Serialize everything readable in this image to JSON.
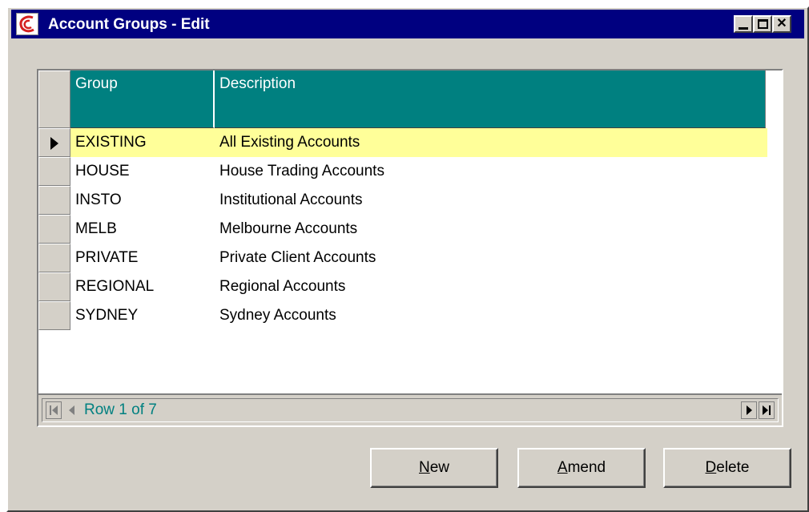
{
  "window": {
    "title": "Account Groups - Edit",
    "controls": {
      "minimize": "_",
      "maximize": "□",
      "close": "×"
    }
  },
  "grid": {
    "columns": [
      "Group",
      "Description"
    ],
    "rows": [
      {
        "group": "EXISTING",
        "description": "All Existing Accounts",
        "selected": true
      },
      {
        "group": "HOUSE",
        "description": "House Trading Accounts"
      },
      {
        "group": "INSTO",
        "description": "Institutional Accounts"
      },
      {
        "group": "MELB",
        "description": "Melbourne Accounts"
      },
      {
        "group": "PRIVATE",
        "description": "Private Client Accounts"
      },
      {
        "group": "REGIONAL",
        "description": "Regional Accounts"
      },
      {
        "group": "SYDNEY",
        "description": "Sydney Accounts"
      }
    ],
    "status": "Row 1 of 7",
    "selected_color": "#ffff99",
    "header_color": "#008080"
  },
  "buttons": {
    "new": {
      "mnemonic": "N",
      "rest": "ew"
    },
    "amend": {
      "mnemonic": "A",
      "rest": "mend"
    },
    "delete": {
      "mnemonic": "D",
      "rest": "elete"
    }
  },
  "icons": [
    "app-logo-icon",
    "minimize-icon",
    "maximize-icon",
    "close-icon",
    "row-pointer-icon",
    "first-record-icon",
    "prev-record-icon",
    "next-record-icon",
    "last-record-icon"
  ]
}
